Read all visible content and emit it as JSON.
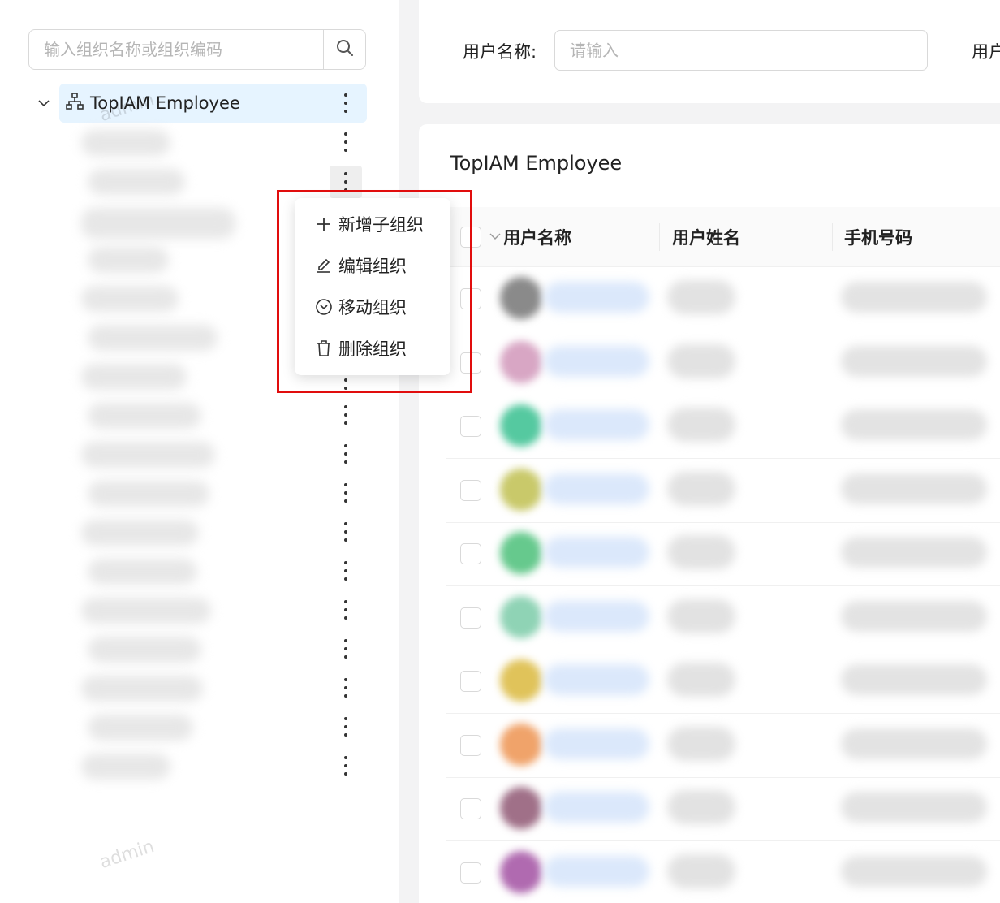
{
  "sidebar": {
    "search": {
      "placeholder": "输入组织名称或组织编码",
      "value": ""
    },
    "tree": {
      "root_label": "TopIAM Employee",
      "expanded": true,
      "child_count": 17
    },
    "context_menu": {
      "items": [
        {
          "label": "新增子组织",
          "icon": "plus-icon"
        },
        {
          "label": "编辑组织",
          "icon": "edit-icon"
        },
        {
          "label": "移动组织",
          "icon": "move-icon"
        },
        {
          "label": "删除组织",
          "icon": "delete-icon"
        }
      ],
      "highlight_color": "#e10d0d"
    }
  },
  "filter": {
    "username_label": "用户名称:",
    "username_placeholder": "请输入",
    "second_label_partial": "用户"
  },
  "table": {
    "title": "TopIAM Employee",
    "columns": [
      "用户名称",
      "用户姓名",
      "手机号码"
    ],
    "avatar_colors": [
      "#8a8a8a",
      "#d8a6c4",
      "#55c9a0",
      "#c9c96a",
      "#66c98d",
      "#8fd3b5",
      "#e0c35a",
      "#f0a36a",
      "#a07088",
      "#b06ab0"
    ]
  },
  "watermark_text": "admin",
  "colors": {
    "tree_selected_bg": "#e6f4ff",
    "page_bg": "#f3f3f4"
  }
}
